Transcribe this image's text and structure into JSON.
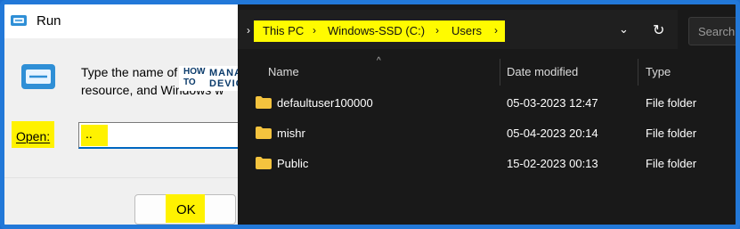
{
  "run_dialog": {
    "title": "Run",
    "description_line1": "Type the name of",
    "description_line2": "resource, and Windows w",
    "open_label": "Open:",
    "open_value": "..",
    "ok_label": "OK"
  },
  "watermark": {
    "how": "HOW",
    "to": "TO",
    "manage": "MANAGE",
    "devices": "DEVICES"
  },
  "explorer": {
    "breadcrumb": [
      "This PC",
      "Windows-SSD (C:)",
      "Users"
    ],
    "search_placeholder": "Search",
    "columns": [
      "Name",
      "Date modified",
      "Type"
    ],
    "rows": [
      {
        "name": "defaultuser100000",
        "date": "05-03-2023 12:47",
        "type": "File folder"
      },
      {
        "name": "mishr",
        "date": "05-04-2023 20:14",
        "type": "File folder"
      },
      {
        "name": "Public",
        "date": "15-02-2023 00:13",
        "type": "File folder"
      }
    ]
  },
  "colors": {
    "highlight": "#fff200",
    "frame_border": "#2278d8",
    "folder": "#f4c33e",
    "crumb_text": "#e8e24a"
  }
}
